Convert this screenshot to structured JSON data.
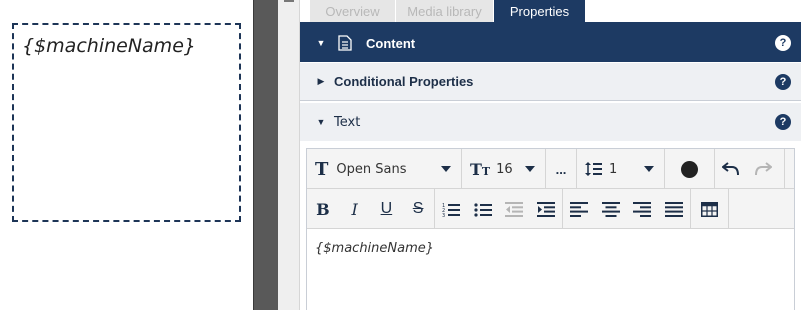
{
  "canvas": {
    "text_box_content": "{$machineName}"
  },
  "tabs": [
    {
      "label": "Overview"
    },
    {
      "label": "Media library"
    },
    {
      "label": "Properties"
    }
  ],
  "sections": {
    "content": {
      "label": "Content",
      "help": "?"
    },
    "conditional": {
      "label": "Conditional Properties",
      "help": "?"
    },
    "text": {
      "label": "Text",
      "help": "?"
    }
  },
  "editor": {
    "font_family": "Open Sans",
    "font_size": "16",
    "line_height": "1",
    "more": "...",
    "content": "{$machineName}"
  },
  "colors": {
    "accent": "#1d3a63",
    "dashed_border": "#1d3557",
    "section_bg": "#eef0f3"
  }
}
